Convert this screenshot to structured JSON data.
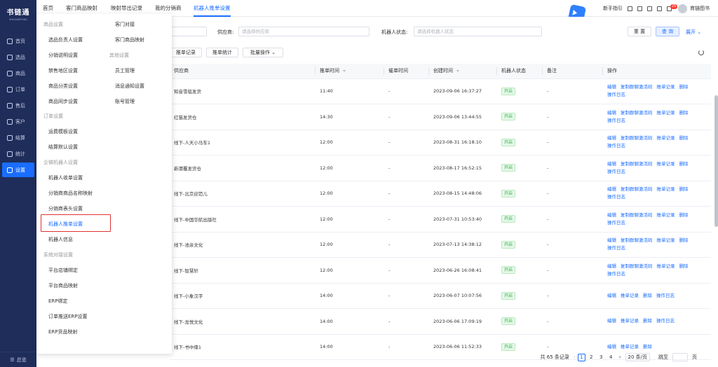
{
  "brand": {
    "title": "书链通",
    "subtitle": "SHULIANTONG"
  },
  "sidebar": {
    "items": [
      {
        "label": "首页"
      },
      {
        "label": "选品"
      },
      {
        "label": "商品"
      },
      {
        "label": "订单"
      },
      {
        "label": "售后"
      },
      {
        "label": "客户"
      },
      {
        "label": "结算"
      },
      {
        "label": "统计"
      },
      {
        "label": "设置"
      }
    ],
    "collapse_label": "总览"
  },
  "tabs": [
    "首页",
    "客门商品映射",
    "映射导出记录",
    "我的分销商",
    "机器人推单设置"
  ],
  "top": {
    "guide": "新手指引",
    "badge": "25",
    "user": "育链图书"
  },
  "filters": {
    "supplier_label": "供应商:",
    "supplier_placeholder": "请选择供应商",
    "robot_status_label": "机器人状态:",
    "robot_status_placeholder": "请选择机器人状态",
    "reset": "重 置",
    "query": "查 询",
    "expand": "展开"
  },
  "actions": {
    "push_log": "推单记录",
    "push_stats": "推单统计",
    "batch": "批量操作"
  },
  "table": {
    "headers": [
      "供应商",
      "推单时间",
      "催单时间",
      "创建时间",
      "机器人状态",
      "备注",
      "操作"
    ],
    "rows": [
      {
        "supplier": "知音雪毯发货",
        "push_time": "11:40",
        "remind": "-",
        "created": "2023-09-06 16:37:27",
        "status": "开启",
        "note": "-",
        "ops": [
          "编辑",
          "复制群聊激活码",
          "推单记录",
          "删除",
          "操作日志"
        ]
      },
      {
        "supplier": "红猫发货仓",
        "push_time": "14:30",
        "remind": "-",
        "created": "2023-09-06 13:44:55",
        "status": "开启",
        "note": "-",
        "ops": [
          "编辑",
          "复制群聊激活码",
          "推单记录",
          "删除",
          "操作日志"
        ]
      },
      {
        "supplier": "线下-人天小马车1",
        "push_time": "12:00",
        "remind": "-",
        "created": "2023-08-31 16:18:10",
        "status": "开启",
        "note": "-",
        "ops": [
          "编辑",
          "复制群聊激活码",
          "推单记录",
          "删除",
          "操作日志"
        ]
      },
      {
        "supplier": "新港覆发货仓",
        "push_time": "12:00",
        "remind": "-",
        "created": "2023-08-17 16:52:15",
        "status": "开启",
        "note": "-",
        "ops": [
          "编辑",
          "复制群聊激活码",
          "推单记录",
          "删除",
          "操作日志"
        ]
      },
      {
        "supplier": "线下-北京迎范儿",
        "push_time": "12:00",
        "remind": "-",
        "created": "2023-08-15 14:48:06",
        "status": "开启",
        "note": "-",
        "ops": [
          "编辑",
          "复制群聊激活码",
          "推单记录",
          "删除",
          "操作日志"
        ]
      },
      {
        "supplier": "线下-中国华航出版社",
        "push_time": "12:00",
        "remind": "-",
        "created": "2023-07-31 10:53:40",
        "status": "开启",
        "note": "-",
        "ops": [
          "编辑",
          "复制群聊激活码",
          "推单记录",
          "删除",
          "操作日志"
        ]
      },
      {
        "supplier": "线下-池亲文化",
        "push_time": "12:00",
        "remind": "-",
        "created": "2023-07-13 14:38:12",
        "status": "开启",
        "note": "-",
        "ops": [
          "编辑",
          "复制群聊激活码",
          "推单记录",
          "删除",
          "操作日志"
        ]
      },
      {
        "supplier": "线下-智慧轩",
        "push_time": "12:00",
        "remind": "-",
        "created": "2023-06-26 16:08:41",
        "status": "开启",
        "note": "-",
        "ops": [
          "编辑",
          "复制群聊激活码",
          "推单记录",
          "删除",
          "操作日志"
        ]
      },
      {
        "supplier": "线下-小象汉字",
        "push_time": "14:00",
        "remind": "-",
        "created": "2023-06-07 10:07:56",
        "status": "开启",
        "note": "-",
        "ops": [
          "编辑",
          "推单记录",
          "删除",
          "操作日志"
        ]
      },
      {
        "supplier": "线下-龙悦文化",
        "push_time": "14:00",
        "remind": "-",
        "created": "2023-06-06 17:09:19",
        "status": "开启",
        "note": "-",
        "ops": [
          "编辑",
          "推单记录",
          "删除",
          "操作日志"
        ]
      },
      {
        "supplier": "线下-书中缘1",
        "push_time": "14:00",
        "remind": "-",
        "created": "2023-06-06 11:52:33",
        "status": "开启",
        "note": "-",
        "ops": [
          "编辑",
          "推单记录",
          "删除"
        ]
      }
    ]
  },
  "pagination": {
    "total": "共 65 条记录",
    "pages": [
      "1",
      "2",
      "3",
      "4"
    ],
    "page_size": "20 条/页",
    "jump_label": "跳至",
    "page_unit": "页"
  },
  "dropdown": {
    "groups": [
      {
        "title": "商品设置",
        "items": [
          "选品负责人设置",
          "分销说明设置",
          "禁售地区设置",
          "商品分类设置",
          "商品同步设置"
        ]
      },
      {
        "title": "订单设置",
        "items": [
          "运费模板设置",
          "结算默认设置"
        ]
      },
      {
        "title": "企微机器人设置",
        "items": [
          "机器人收单设置",
          "分销商商品名称映射",
          "分销商表头设置",
          "机器人推单设置",
          "机器人信息"
        ]
      },
      {
        "title": "系统对接设置",
        "items": [
          "平台店铺绑定",
          "平台商品映射",
          "ERP绑定",
          "订单推送ERP设置",
          "ERP货品映射"
        ]
      }
    ],
    "right_items": [
      "客门对接",
      "客门商品映射"
    ],
    "right_group": {
      "title": "其他设置",
      "items": [
        "员工管理",
        "消息通知设置",
        "账号管理"
      ]
    }
  }
}
